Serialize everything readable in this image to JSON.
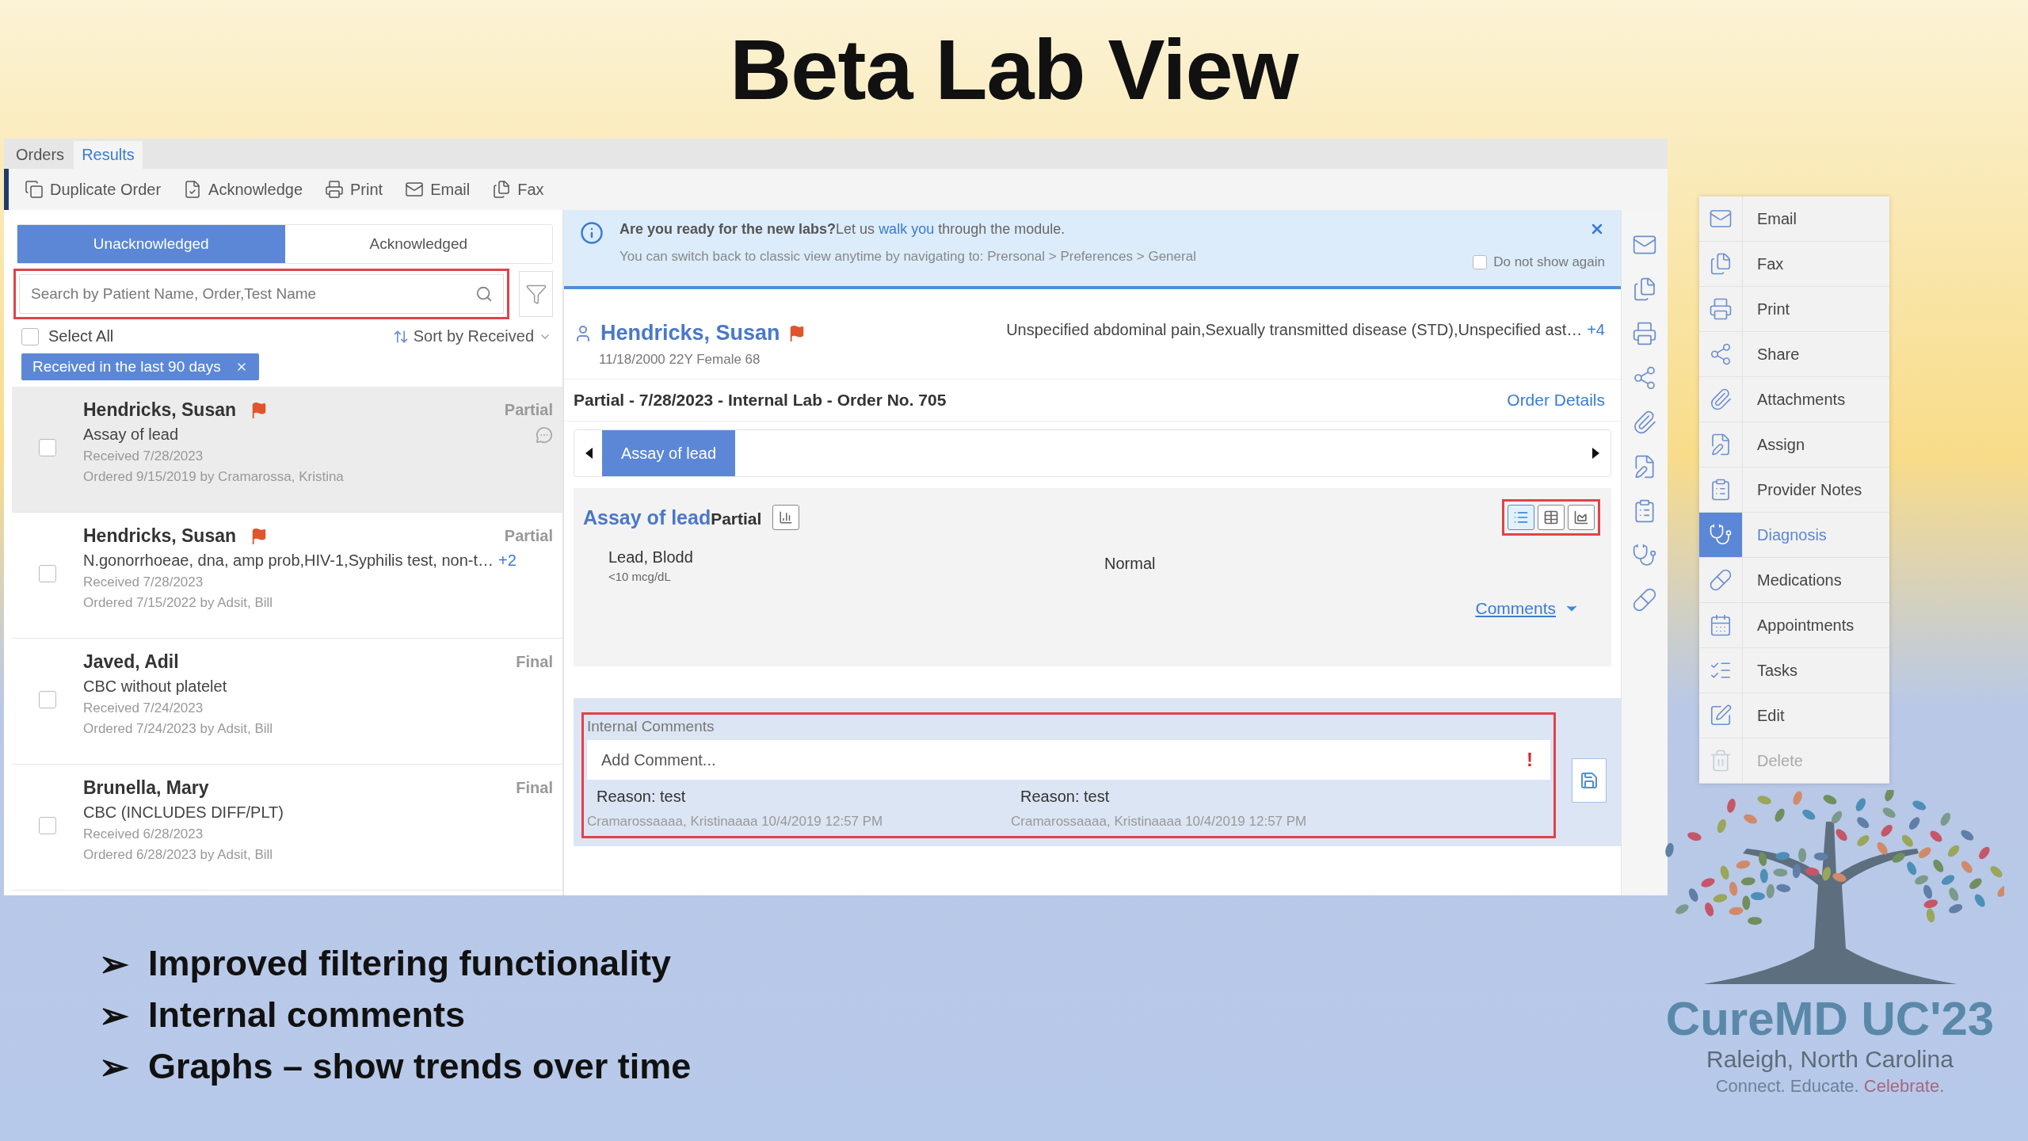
{
  "slide": {
    "title": "Beta Lab View",
    "bullet_marker": "➢",
    "bullets": [
      "Improved filtering functionality",
      "Internal comments",
      "Graphs – show trends over time"
    ]
  },
  "app": {
    "tabs": [
      {
        "label": "Orders",
        "selected": false
      },
      {
        "label": "Results",
        "selected": true
      }
    ],
    "toolbar": [
      "Duplicate Order",
      "Acknowledge",
      "Print",
      "Email",
      "Fax"
    ],
    "filter_tabs": [
      {
        "label": "Unacknowledged",
        "selected": true
      },
      {
        "label": "Acknowledged",
        "selected": false
      }
    ],
    "search": {
      "placeholder": "Search by Patient Name, Order,Test Name",
      "highlighted": true
    },
    "select_all": {
      "label": "Select All",
      "checked": false
    },
    "sort": {
      "label": "Sort by Received"
    },
    "filter_chip": {
      "label": "Received in the last 90 days"
    },
    "results": [
      {
        "name": "Hendricks, Susan",
        "flagged": true,
        "status": "Partial",
        "test": "Assay of lead",
        "received": "Received 7/28/2023",
        "ordered": "Ordered 9/15/2019 by  Cramarossa, Kristina",
        "checked": false,
        "selected": true,
        "has_comment": true
      },
      {
        "name": "Hendricks, Susan",
        "flagged": true,
        "status": "Partial",
        "test": "N.gonorrhoeae, dna, amp prob,HIV-1,Syphilis test, non-t…",
        "more": "+2",
        "received": "Received 7/28/2023",
        "ordered": "Ordered 7/15/2022 by  Adsit, Bill",
        "checked": false,
        "selected": false,
        "has_comment": false
      },
      {
        "name": "Javed, Adil",
        "flagged": false,
        "status": "Final",
        "test": "CBC without platelet",
        "received": "Received 7/24/2023",
        "ordered": "Ordered 7/24/2023 by  Adsit, Bill",
        "checked": false,
        "selected": false,
        "has_comment": false
      },
      {
        "name": "Brunella, Mary",
        "flagged": false,
        "status": "Final",
        "test": "CBC (INCLUDES DIFF/PLT)",
        "received": "Received 6/28/2023",
        "ordered": "Ordered 6/28/2023 by  Adsit, Bill",
        "checked": false,
        "selected": false,
        "has_comment": false
      }
    ],
    "banner": {
      "before": "**Are you ready for the new labs?**Let us ",
      "link": "walk you",
      "after": " through the module.",
      "note": "You can switch back to classic view anytime by navigating to: Prersonal > Preferences > General",
      "checkbox": {
        "label": "Do not show again",
        "checked": false
      }
    },
    "patient": {
      "name": "Hendricks, Susan",
      "flagged": true,
      "details": "11/18/2000 22Y Female 68",
      "diagnoses": "Unspecified abdominal pain,Sexually transmitted disease (STD),Unspecified ast…",
      "more": "+4"
    },
    "order": {
      "summary": "Partial - 7/28/2023 - Internal Lab - Order No. 705",
      "link": "Order Details"
    },
    "test_tabs": [
      {
        "label": "Assay of lead",
        "selected": true
      }
    ],
    "result_card": {
      "title": "Assay of lead",
      "status": "Partial",
      "view_toggle": {
        "highlighted": true,
        "options": [
          {
            "kind": "list",
            "selected": true
          },
          {
            "kind": "table",
            "selected": false
          },
          {
            "kind": "chart",
            "selected": false
          }
        ]
      },
      "rows": [
        {
          "name": "Lead, Blodd",
          "range": "<10 mcg/dL",
          "flag": "Normal"
        }
      ],
      "comments_link": "Comments"
    },
    "internal_comments": {
      "label": "Internal Comments",
      "placeholder": "Add Comment...",
      "required_mark": "!",
      "highlighted": true,
      "entries": [
        {
          "reason": "Reason: test",
          "author": "Cramarossaaaa, Kristinaaaa 10/4/2019 12:57 PM"
        },
        {
          "reason": "Reason: test",
          "author": "Cramarossaaaa, Kristinaaaa 10/4/2019 12:57 PM"
        }
      ]
    }
  },
  "side_menu": [
    {
      "label": "Email",
      "selected": false,
      "disabled": false
    },
    {
      "label": "Fax",
      "selected": false,
      "disabled": false
    },
    {
      "label": "Print",
      "selected": false,
      "disabled": false
    },
    {
      "label": "Share",
      "selected": false,
      "disabled": false
    },
    {
      "label": "Attachments",
      "selected": false,
      "disabled": false
    },
    {
      "label": "Assign",
      "selected": false,
      "disabled": false
    },
    {
      "label": "Provider Notes",
      "selected": false,
      "disabled": false
    },
    {
      "label": "Diagnosis",
      "selected": true,
      "disabled": false
    },
    {
      "label": "Medications",
      "selected": false,
      "disabled": false
    },
    {
      "label": "Appointments",
      "selected": false,
      "disabled": false
    },
    {
      "label": "Tasks",
      "selected": false,
      "disabled": false
    },
    {
      "label": "Edit",
      "selected": false,
      "disabled": false
    },
    {
      "label": "Delete",
      "selected": false,
      "disabled": true
    }
  ],
  "logo": {
    "name": "CureMD UC'23",
    "location": "Raleigh, North Carolina",
    "tagline": [
      {
        "text": "Connect. Educate.",
        "color": "#6d8198"
      },
      {
        "text": "Celebrate.",
        "color": "#a4687e"
      }
    ]
  }
}
